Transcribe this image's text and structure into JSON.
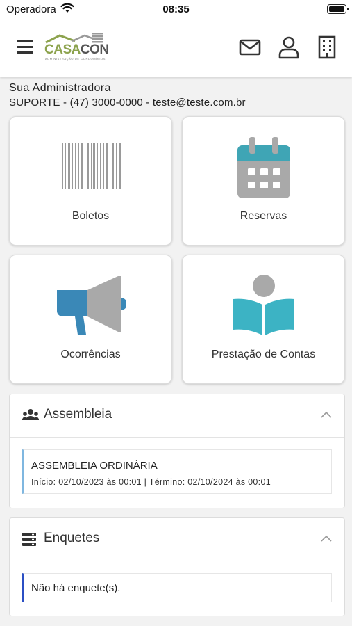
{
  "status_bar": {
    "carrier": "Operadora",
    "time": "08:35"
  },
  "header": {
    "logo": {
      "brand_part1": "CASA",
      "brand_part2": "CON",
      "tagline": "ADMINISTRAÇÃO DE CONDOMÍNIOS"
    },
    "icons": [
      "menu-icon",
      "mail-icon",
      "user-icon",
      "building-icon"
    ]
  },
  "admin": {
    "title": "Sua Administradora",
    "contact": "SUPORTE - (47) 3000-0000 - teste@teste.com.br"
  },
  "tiles": [
    {
      "label": "Boletos",
      "icon": "barcode-icon"
    },
    {
      "label": "Reservas",
      "icon": "calendar-icon"
    },
    {
      "label": "Ocorrências",
      "icon": "megaphone-icon"
    },
    {
      "label": "Prestação de Contas",
      "icon": "book-reader-icon"
    }
  ],
  "assembleia": {
    "title": "Assembleia",
    "items": [
      {
        "name": "ASSEMBLEIA ORDINÁRIA",
        "period": "Início: 02/10/2023 às 00:01 | Término: 02/10/2024 às 00:01"
      }
    ]
  },
  "enquetes": {
    "title": "Enquetes",
    "empty_message": "Não há enquete(s)."
  },
  "colors": {
    "brand_green": "#8da34e",
    "calendar_teal": "#3fa5b5",
    "megaphone_blue": "#3a88b7",
    "book_teal": "#3cb3c4",
    "icon_gray": "#a9a9a9"
  }
}
